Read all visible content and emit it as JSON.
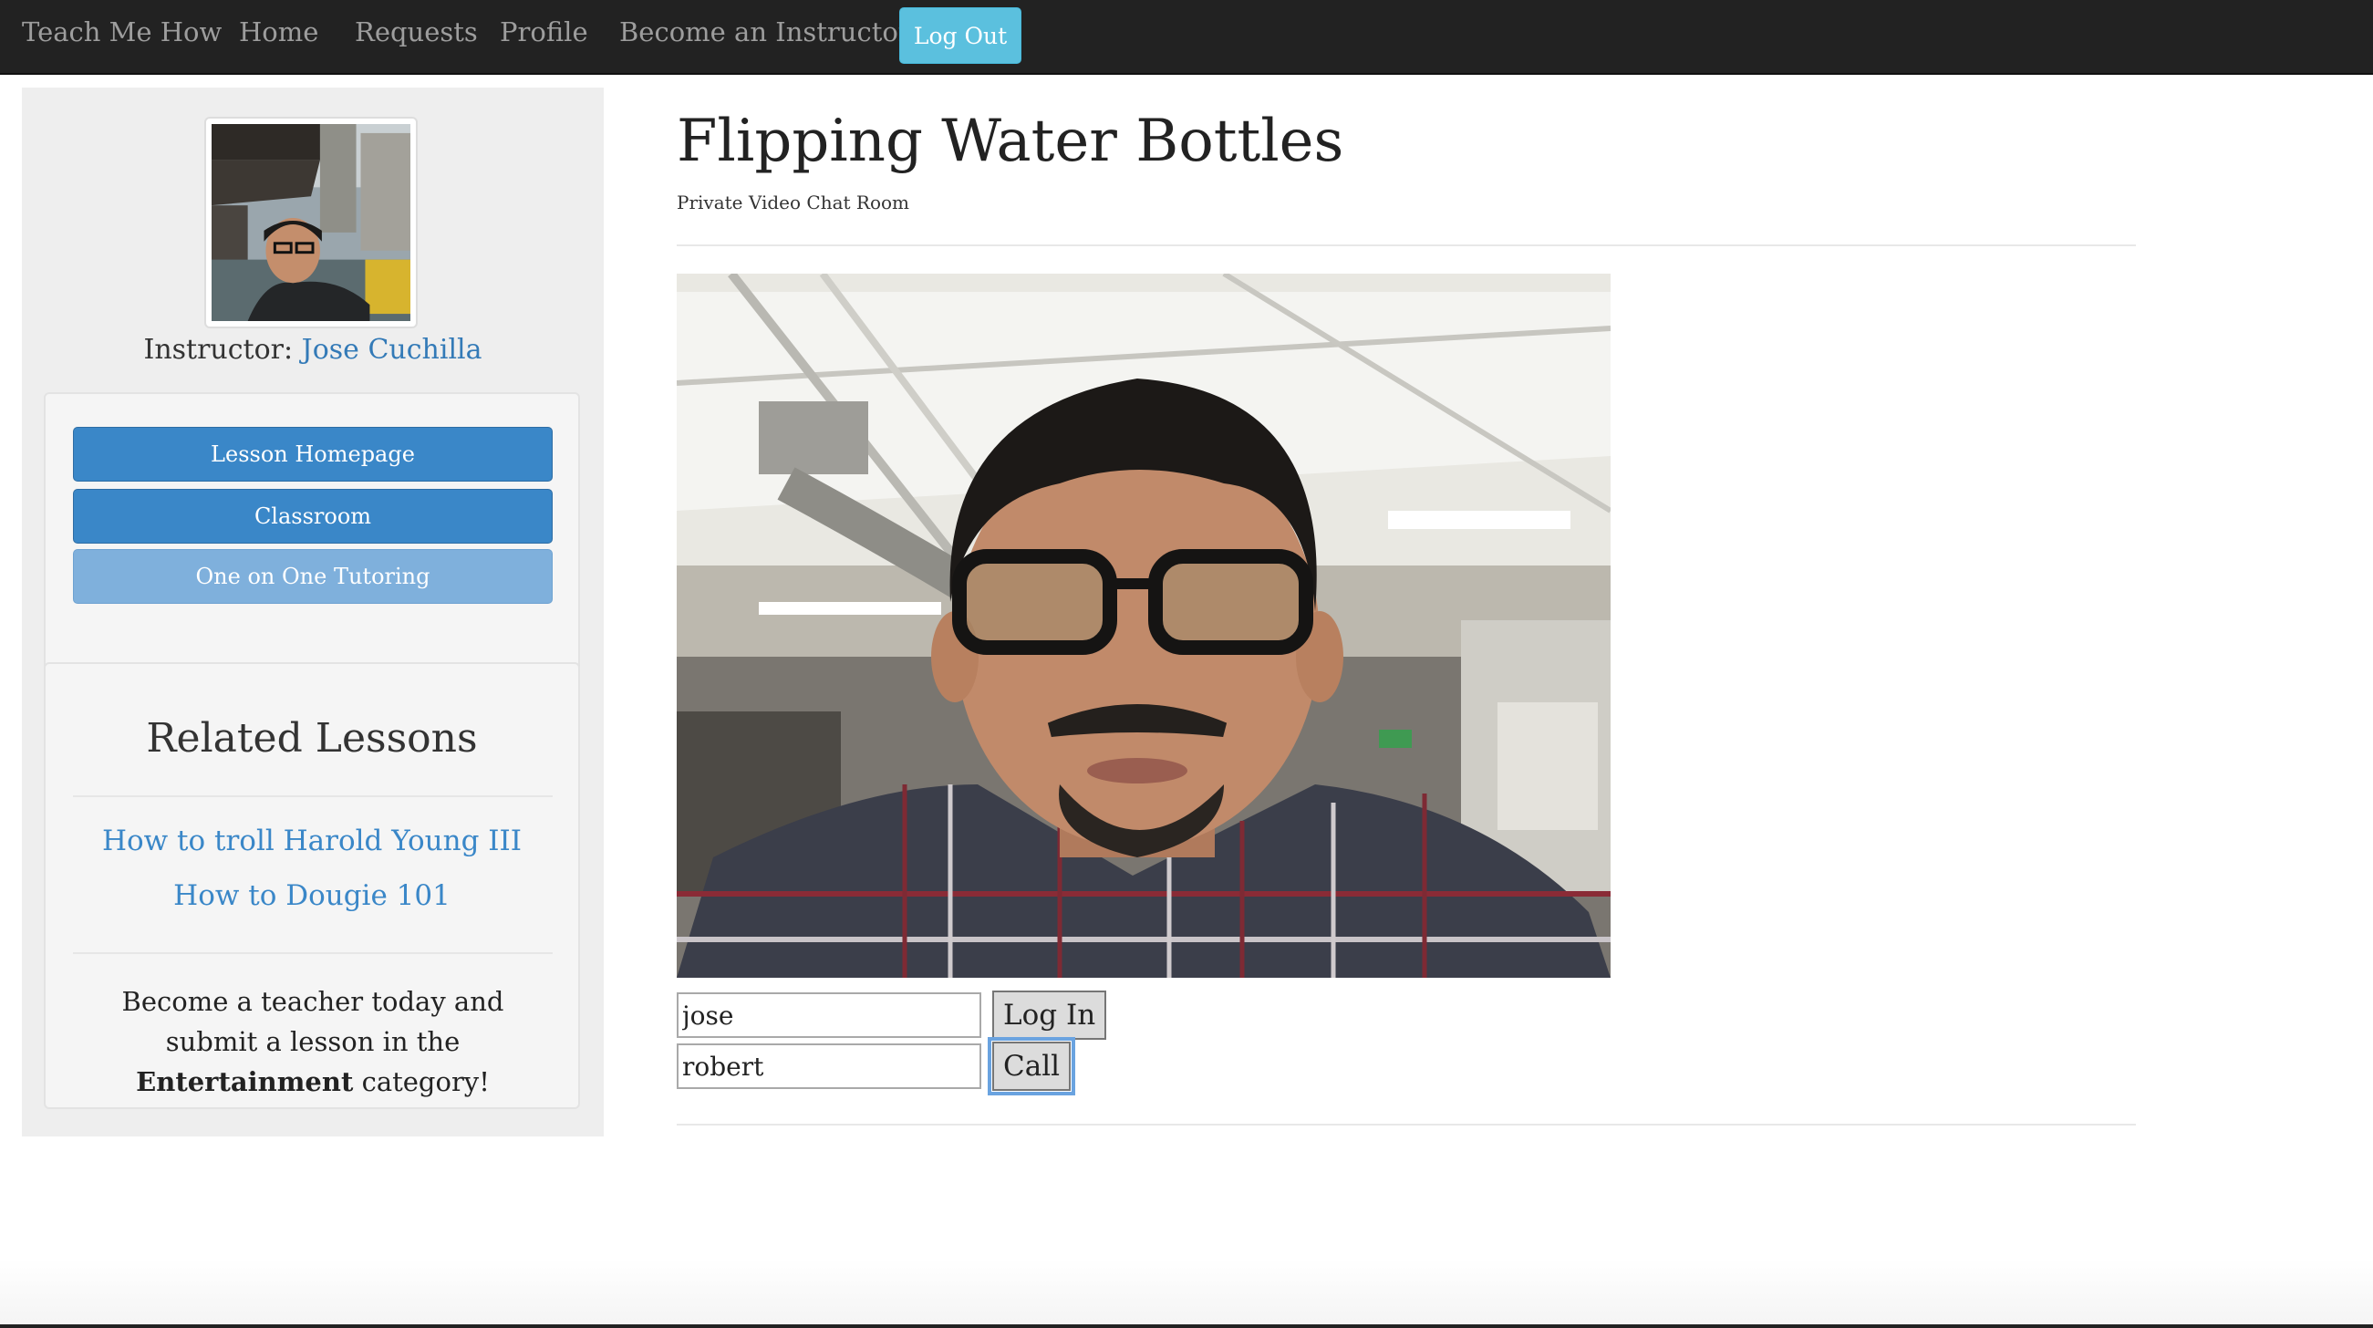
{
  "navbar": {
    "brand": "Teach Me How",
    "links": [
      "Home",
      "Requests",
      "Profile",
      "Become an Instructor!"
    ],
    "logout_label": "Log Out",
    "background": "#222222",
    "logout_color": "#5bc0de"
  },
  "sidebar": {
    "instructor_prefix": "Instructor:",
    "instructor_name": "Jose Cuchilla",
    "nav_buttons": [
      "Lesson Homepage",
      "Classroom",
      "One on One Tutoring"
    ],
    "active_button": "One on One Tutoring",
    "related_title": "Related Lessons",
    "related_links": [
      "How to troll Harold Young III",
      "How to Dougie 101"
    ],
    "cta_pre": "Become a teacher today and submit a lesson in the",
    "cta_category": "Entertainment",
    "cta_post": "category!"
  },
  "main": {
    "title": "Flipping Water Bottles",
    "subtitle": "Private Video Chat Room",
    "username_value": "jose",
    "login_label": "Log In",
    "callee_value": "robert",
    "call_label": "Call"
  },
  "colors": {
    "link": "#337ab7",
    "primary_button": "#3a87c8",
    "active_button": "#7fb0dc"
  },
  "icons": {
    "avatar": "instructor-avatar-photo",
    "video": "webcam-video-feed"
  }
}
